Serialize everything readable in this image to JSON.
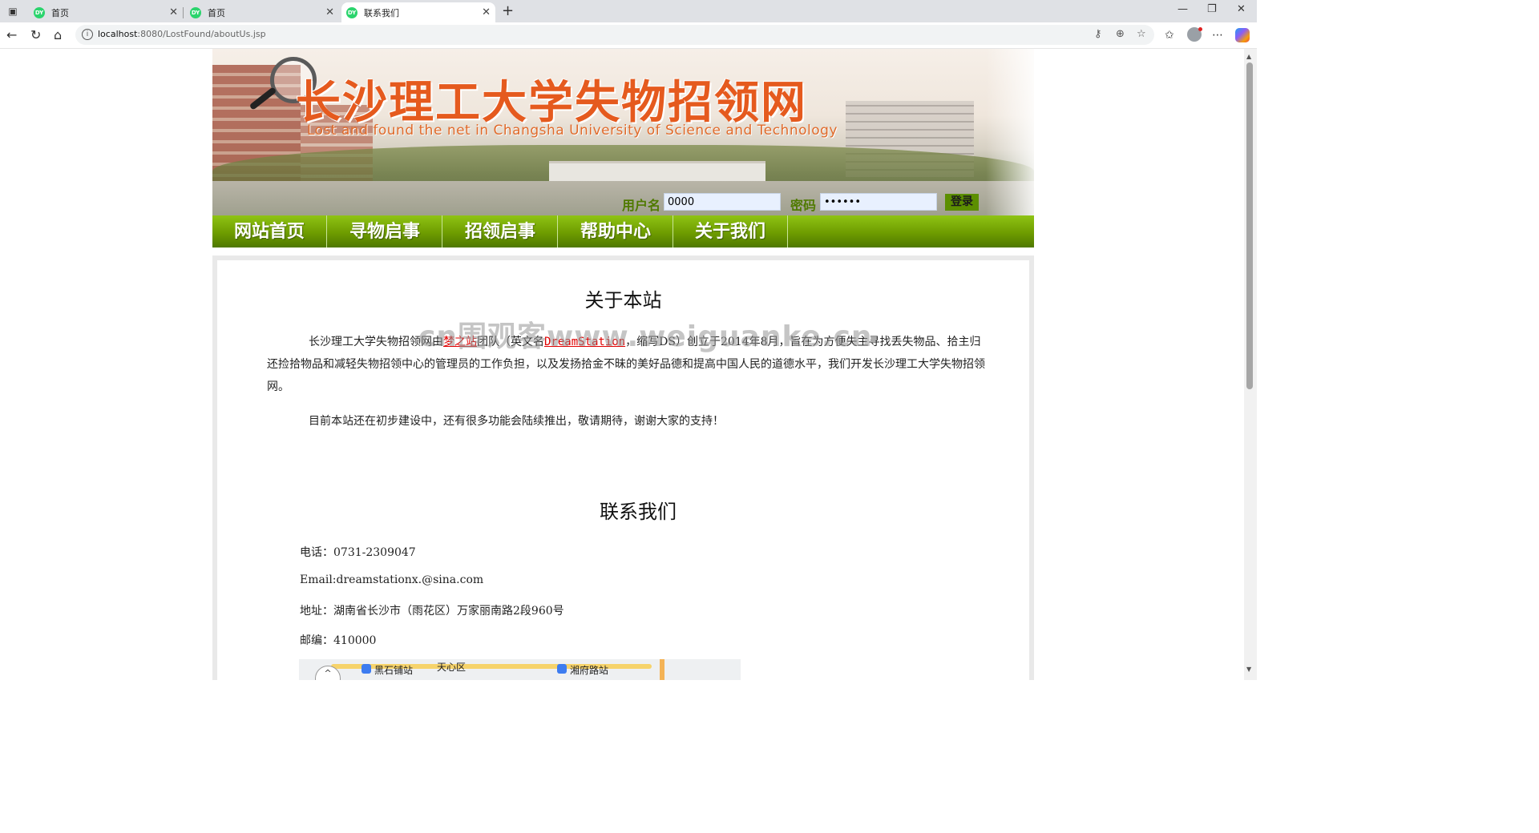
{
  "browser": {
    "tabs": [
      {
        "favicon": "DY",
        "title": "首页"
      },
      {
        "favicon": "DY",
        "title": "首页"
      },
      {
        "favicon": "DY",
        "title": "联系我们"
      }
    ],
    "url_host": "localhost",
    "url_path": ":8080/LostFound/aboutUs.jsp"
  },
  "banner": {
    "title": "长沙理工大学失物招领网",
    "subtitle": "Lost and found the net in Changsha University of Science and Technology"
  },
  "login": {
    "username_label": "用户名",
    "username_value": "0000",
    "password_label": "密码",
    "password_value": "••••••",
    "login_button": "登录"
  },
  "nav": {
    "items": [
      "网站首页",
      "寻物启事",
      "招领启事",
      "帮助中心",
      "关于我们"
    ]
  },
  "about": {
    "heading": "关于本站",
    "para1_a": "长沙理工大学失物招领网由",
    "para1_link1": "梦之站",
    "para1_b": "团队（英文名",
    "para1_link2": "DreamStation",
    "para1_c": "，缩写DS）创立于2014年8月，旨在为方便失主寻找丢失物品、拾主归还捡拾物品和减轻失物招领中心的管理员的工作负担，以及发扬拾金不昧的美好品德和提高中国人民的道德水平，我们开发长沙理工大学失物招领网。",
    "para2": "目前本站还在初步建设中，还有很多功能会陆续推出，敬请期待，谢谢大家的支持！"
  },
  "contact": {
    "heading": "联系我们",
    "phone": "电话：0731-2309047",
    "email": "Email:dreamstationx.@sina.com",
    "address": "地址：湖南省长沙市（雨花区）万家丽南路2段960号",
    "postcode": "邮编：410000"
  },
  "map": {
    "labels": [
      "黑石铺站",
      "天心区",
      "湘府路站"
    ]
  },
  "watermark": "cn围观客www.weiguanke.cn"
}
